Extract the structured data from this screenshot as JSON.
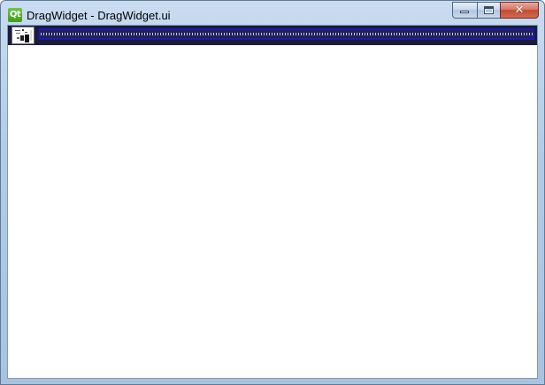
{
  "window": {
    "title": "DragWidget - DragWidget.ui",
    "app_icon_label": "Qt"
  },
  "caption_buttons": {
    "close_glyph": "✕"
  },
  "toolbar": {
    "icons": [
      "drag-widget-icon"
    ]
  },
  "colors": {
    "toolbar_background": "#1c1c3a",
    "dock_border": "#1a1ab4",
    "client_background": "#ffffff",
    "qt_icon": "#4caf2a"
  }
}
